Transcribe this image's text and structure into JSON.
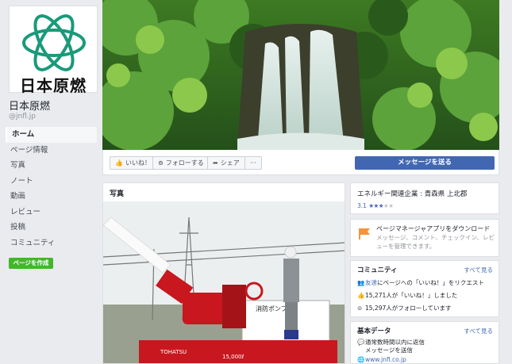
{
  "page": {
    "logo_text": "日本原燃",
    "name": "日本原燃",
    "handle": "@jnfl.jp"
  },
  "nav": {
    "items": [
      {
        "label": "ホーム",
        "active": true
      },
      {
        "label": "ページ情報"
      },
      {
        "label": "写真"
      },
      {
        "label": "ノート"
      },
      {
        "label": "動画"
      },
      {
        "label": "レビュー"
      },
      {
        "label": "投稿"
      },
      {
        "label": "コミュニティ"
      }
    ],
    "create_page": "ページを作成"
  },
  "actions": {
    "like": "いいね！",
    "follow": "フォローする",
    "share": "シェア",
    "more": "···",
    "message": "メッセージを送る"
  },
  "photos": {
    "title": "写真",
    "sign_text": "消防ポンプ車",
    "brand_text": "TOHATSU",
    "capacity_text": "15,000ℓ"
  },
  "about": {
    "category": "エネルギー関連企業 : 青森県 上北郡",
    "rating_value": "3.1",
    "rating_stars": 3
  },
  "pages_manager": {
    "title": "ページマネージャアプリをダウンロード",
    "description": "メッセージ、コメント、チェックイン、レビューを管理できます。"
  },
  "community": {
    "title": "コミュニティ",
    "see_all": "すべて見る",
    "invite_link": "友達",
    "invite_text": "にページへの「いいね！」をリクエスト",
    "likes": "15,271人が「いいね！」しました",
    "follows": "15,297人がフォローしています"
  },
  "basic": {
    "title": "基本データ",
    "see_all": "すべて見る",
    "response": "通常数時間以内に返信",
    "send_message": "メッセージを送信",
    "website": "www.jnfl.co.jp"
  },
  "colors": {
    "brand_blue": "#4267b2",
    "create_green": "#42b72a",
    "logo_teal": "#1a9a7a",
    "pump_red": "#c8171e"
  },
  "icons": [
    "like-icon",
    "rss-icon",
    "share-icon",
    "flag-icon",
    "friends-icon",
    "thumbs-up-icon",
    "rss-icon",
    "chat-icon",
    "globe-icon"
  ]
}
